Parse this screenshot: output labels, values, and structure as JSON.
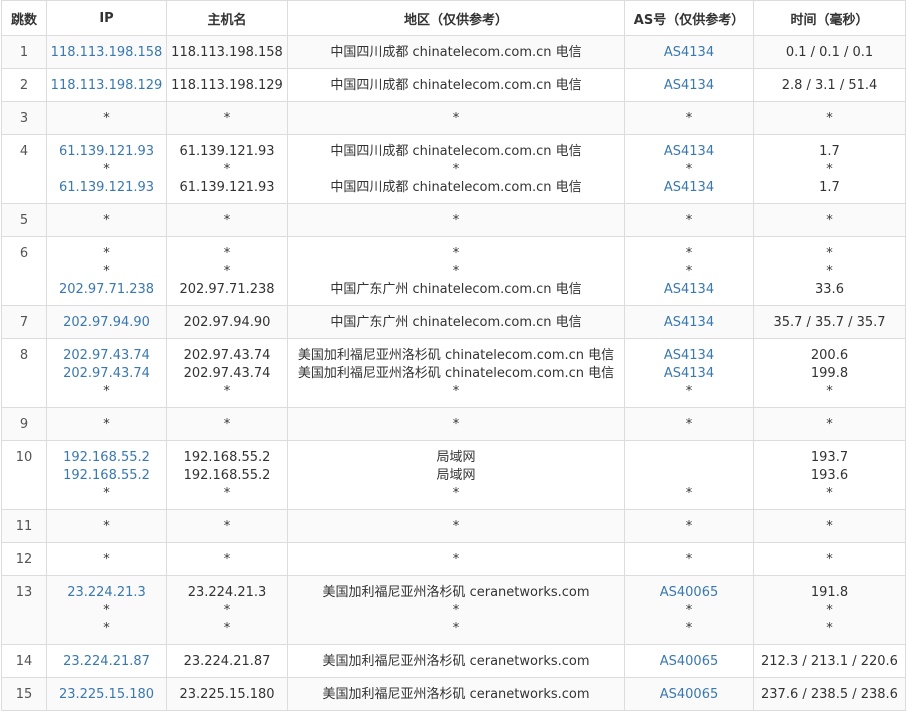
{
  "headers": {
    "hop": "跳数",
    "ip": "IP",
    "host": "主机名",
    "region": "地区（仅供参考）",
    "asn": "AS号（仅供参考）",
    "time": "时间（毫秒）"
  },
  "rows": [
    {
      "hop": "1",
      "ip": [
        "118.113.198.158"
      ],
      "host": [
        "118.113.198.158"
      ],
      "region": [
        "中国四川成都 chinatelecom.com.cn 电信"
      ],
      "asn": [
        "AS4134"
      ],
      "time": [
        "0.1 / 0.1 / 0.1"
      ]
    },
    {
      "hop": "2",
      "ip": [
        "118.113.198.129"
      ],
      "host": [
        "118.113.198.129"
      ],
      "region": [
        "中国四川成都 chinatelecom.com.cn 电信"
      ],
      "asn": [
        "AS4134"
      ],
      "time": [
        "2.8 / 3.1 / 51.4"
      ]
    },
    {
      "hop": "3",
      "ip": [
        "*"
      ],
      "host": [
        "*"
      ],
      "region": [
        "*"
      ],
      "asn": [
        "*"
      ],
      "time": [
        "*"
      ]
    },
    {
      "hop": "4",
      "ip": [
        "61.139.121.93",
        "*",
        "61.139.121.93"
      ],
      "host": [
        "61.139.121.93",
        "*",
        "61.139.121.93"
      ],
      "region": [
        "中国四川成都 chinatelecom.com.cn 电信",
        "*",
        "中国四川成都 chinatelecom.com.cn 电信"
      ],
      "asn": [
        "AS4134",
        "*",
        "AS4134"
      ],
      "time": [
        "1.7",
        "*",
        "1.7"
      ]
    },
    {
      "hop": "5",
      "ip": [
        "*"
      ],
      "host": [
        "*"
      ],
      "region": [
        "*"
      ],
      "asn": [
        "*"
      ],
      "time": [
        "*"
      ]
    },
    {
      "hop": "6",
      "ip": [
        "*",
        "*",
        "202.97.71.238"
      ],
      "host": [
        "*",
        "*",
        "202.97.71.238"
      ],
      "region": [
        "*",
        "*",
        "中国广东广州 chinatelecom.com.cn 电信"
      ],
      "asn": [
        "*",
        "*",
        "AS4134"
      ],
      "time": [
        "*",
        "*",
        "33.6"
      ]
    },
    {
      "hop": "7",
      "ip": [
        "202.97.94.90"
      ],
      "host": [
        "202.97.94.90"
      ],
      "region": [
        "中国广东广州 chinatelecom.com.cn 电信"
      ],
      "asn": [
        "AS4134"
      ],
      "time": [
        "35.7 / 35.7 / 35.7"
      ]
    },
    {
      "hop": "8",
      "ip": [
        "202.97.43.74",
        "202.97.43.74",
        "*"
      ],
      "host": [
        "202.97.43.74",
        "202.97.43.74",
        "*"
      ],
      "region": [
        "美国加利福尼亚州洛杉矶 chinatelecom.com.cn 电信",
        "美国加利福尼亚州洛杉矶 chinatelecom.com.cn 电信",
        "*"
      ],
      "asn": [
        "AS4134",
        "AS4134",
        "*"
      ],
      "time": [
        "200.6",
        "199.8",
        "*"
      ]
    },
    {
      "hop": "9",
      "ip": [
        "*"
      ],
      "host": [
        "*"
      ],
      "region": [
        "*"
      ],
      "asn": [
        "*"
      ],
      "time": [
        "*"
      ]
    },
    {
      "hop": "10",
      "ip": [
        "192.168.55.2",
        "192.168.55.2",
        "*"
      ],
      "host": [
        "192.168.55.2",
        "192.168.55.2",
        "*"
      ],
      "region": [
        "局域网",
        "局域网",
        "*"
      ],
      "asn": [
        "",
        "",
        "*"
      ],
      "time": [
        "193.7",
        "193.6",
        "*"
      ]
    },
    {
      "hop": "11",
      "ip": [
        "*"
      ],
      "host": [
        "*"
      ],
      "region": [
        "*"
      ],
      "asn": [
        "*"
      ],
      "time": [
        "*"
      ]
    },
    {
      "hop": "12",
      "ip": [
        "*"
      ],
      "host": [
        "*"
      ],
      "region": [
        "*"
      ],
      "asn": [
        "*"
      ],
      "time": [
        "*"
      ]
    },
    {
      "hop": "13",
      "ip": [
        "23.224.21.3",
        "*",
        "*"
      ],
      "host": [
        "23.224.21.3",
        "*",
        "*"
      ],
      "region": [
        "美国加利福尼亚州洛杉矶 ceranetworks.com",
        "*",
        "*"
      ],
      "asn": [
        "AS40065",
        "*",
        "*"
      ],
      "time": [
        "191.8",
        "*",
        "*"
      ]
    },
    {
      "hop": "14",
      "ip": [
        "23.224.21.87"
      ],
      "host": [
        "23.224.21.87"
      ],
      "region": [
        "美国加利福尼亚州洛杉矶 ceranetworks.com"
      ],
      "asn": [
        "AS40065"
      ],
      "time": [
        "212.3 / 213.1 / 220.6"
      ]
    },
    {
      "hop": "15",
      "ip": [
        "23.225.15.180"
      ],
      "host": [
        "23.225.15.180"
      ],
      "region": [
        "美国加利福尼亚州洛杉矶 ceranetworks.com"
      ],
      "asn": [
        "AS40065"
      ],
      "time": [
        "237.6 / 238.5 / 238.6"
      ]
    }
  ],
  "colors": {
    "link": "#3a78b0",
    "text": "#333333",
    "border": "#dcdcdc",
    "stripe": "#fafafa"
  }
}
